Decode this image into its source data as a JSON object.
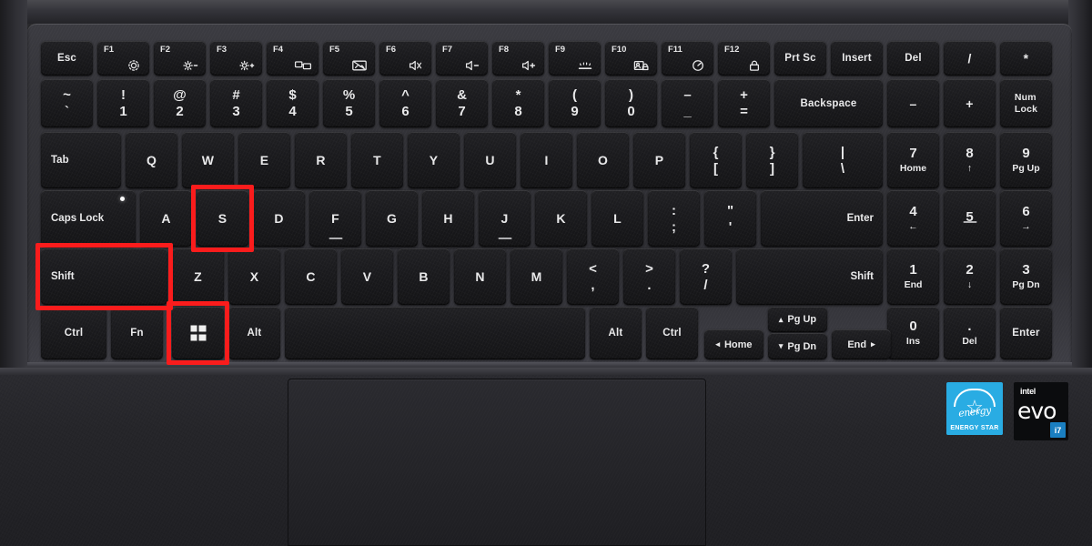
{
  "device": {
    "type": "laptop-keyboard",
    "highlight_color": "#fa1c1c",
    "highlighted_keys": [
      "S",
      "Shift",
      "Windows"
    ],
    "shortcut": "Windows + Shift + S"
  },
  "badges": {
    "energy_star": {
      "caption": "ENERGY STAR",
      "script": "energy",
      "color": "#29ace3"
    },
    "intel_evo": {
      "brand": "intel",
      "word": "evo",
      "tier": "i7",
      "color": "#1a7fc1"
    }
  },
  "rows": {
    "function_row": [
      {
        "id": "esc",
        "label": "Esc",
        "style": "center-small"
      },
      {
        "id": "f1",
        "fx": "F1",
        "icon": "gear-icon"
      },
      {
        "id": "f2",
        "fx": "F2",
        "icon": "brightness-down-icon"
      },
      {
        "id": "f3",
        "fx": "F3",
        "icon": "brightness-up-icon"
      },
      {
        "id": "f4",
        "fx": "F4",
        "icon": "display-switch-icon"
      },
      {
        "id": "f5",
        "fx": "F5",
        "icon": "screen-off-icon"
      },
      {
        "id": "f6",
        "fx": "F6",
        "icon": "mute-icon"
      },
      {
        "id": "f7",
        "fx": "F7",
        "icon": "volume-down-icon"
      },
      {
        "id": "f8",
        "fx": "F8",
        "icon": "volume-up-icon"
      },
      {
        "id": "f9",
        "fx": "F9",
        "icon": "keyboard-backlight-icon"
      },
      {
        "id": "f10",
        "fx": "F10",
        "icon": "privacy-lock-icon"
      },
      {
        "id": "f11",
        "fx": "F11",
        "icon": "performance-gauge-icon"
      },
      {
        "id": "f12",
        "fx": "F12",
        "icon": "lock-icon"
      },
      {
        "id": "prtsc",
        "label": "Prt Sc",
        "style": "center-small"
      },
      {
        "id": "insert",
        "label": "Insert",
        "style": "center-small"
      },
      {
        "id": "del",
        "label": "Del",
        "style": "center-small"
      },
      {
        "id": "numpad-divide",
        "label": "/",
        "style": "center"
      },
      {
        "id": "numpad-multiply",
        "label": "*",
        "style": "center"
      },
      {
        "id": "power",
        "label": "",
        "style": "center"
      }
    ],
    "number_row": [
      {
        "id": "backtick",
        "up": "~",
        "lo": "`"
      },
      {
        "id": "1",
        "up": "!",
        "lo": "1"
      },
      {
        "id": "2",
        "up": "@",
        "lo": "2"
      },
      {
        "id": "3",
        "up": "#",
        "lo": "3"
      },
      {
        "id": "4",
        "up": "$",
        "lo": "4"
      },
      {
        "id": "5",
        "up": "%",
        "lo": "5"
      },
      {
        "id": "6",
        "up": "^",
        "lo": "6"
      },
      {
        "id": "7",
        "up": "&",
        "lo": "7"
      },
      {
        "id": "8",
        "up": "*",
        "lo": "8"
      },
      {
        "id": "9",
        "up": "(",
        "lo": "9"
      },
      {
        "id": "0",
        "up": ")",
        "lo": "0"
      },
      {
        "id": "minus",
        "up": "–",
        "lo": "_"
      },
      {
        "id": "equal",
        "up": "+",
        "lo": "="
      },
      {
        "id": "backspace",
        "label": "Backspace",
        "style": "center-small"
      },
      {
        "id": "numpad-minus",
        "label": "–",
        "style": "center"
      },
      {
        "id": "numpad-plus",
        "label": "+",
        "style": "center"
      },
      {
        "id": "numlock",
        "label": "Num\nLock",
        "style": "stack-word"
      }
    ],
    "top_letter_row": [
      {
        "id": "tab",
        "label": "Tab",
        "style": "left-small"
      },
      {
        "id": "q",
        "label": "Q"
      },
      {
        "id": "w",
        "label": "W"
      },
      {
        "id": "e",
        "label": "E"
      },
      {
        "id": "r",
        "label": "R"
      },
      {
        "id": "t",
        "label": "T"
      },
      {
        "id": "y",
        "label": "Y"
      },
      {
        "id": "u",
        "label": "U"
      },
      {
        "id": "i",
        "label": "I"
      },
      {
        "id": "o",
        "label": "O"
      },
      {
        "id": "p",
        "label": "P"
      },
      {
        "id": "bracket-left",
        "up": "{",
        "lo": "["
      },
      {
        "id": "bracket-right",
        "up": "}",
        "lo": "]"
      },
      {
        "id": "backslash",
        "up": "|",
        "lo": "\\"
      },
      {
        "id": "np7",
        "big": "7",
        "sub": "Home"
      },
      {
        "id": "np8",
        "big": "8",
        "sub": "↑"
      },
      {
        "id": "np9",
        "big": "9",
        "sub": "Pg Up"
      }
    ],
    "home_row": [
      {
        "id": "capslock",
        "label": "Caps Lock",
        "style": "left-small",
        "led": true
      },
      {
        "id": "a",
        "label": "A"
      },
      {
        "id": "s",
        "label": "S",
        "highlight": true
      },
      {
        "id": "d",
        "label": "D"
      },
      {
        "id": "f",
        "label": "F",
        "homing": true
      },
      {
        "id": "g",
        "label": "G"
      },
      {
        "id": "h",
        "label": "H"
      },
      {
        "id": "j",
        "label": "J",
        "homing": true
      },
      {
        "id": "k",
        "label": "K"
      },
      {
        "id": "l",
        "label": "L"
      },
      {
        "id": "semicolon",
        "up": ":",
        "lo": ";"
      },
      {
        "id": "quote",
        "up": "\"",
        "lo": "'"
      },
      {
        "id": "enter",
        "label": "Enter",
        "style": "right-small"
      },
      {
        "id": "np4",
        "big": "4",
        "sub": "←"
      },
      {
        "id": "np5",
        "big": "5",
        "sub": "",
        "homing": true
      },
      {
        "id": "np6",
        "big": "6",
        "sub": "→"
      }
    ],
    "bottom_letter_row": [
      {
        "id": "shift-left",
        "label": "Shift",
        "style": "left-small",
        "highlight": true
      },
      {
        "id": "z",
        "label": "Z"
      },
      {
        "id": "x",
        "label": "X"
      },
      {
        "id": "c",
        "label": "C"
      },
      {
        "id": "v",
        "label": "V"
      },
      {
        "id": "b",
        "label": "B"
      },
      {
        "id": "n",
        "label": "N"
      },
      {
        "id": "m",
        "label": "M"
      },
      {
        "id": "comma",
        "up": "<",
        "lo": ","
      },
      {
        "id": "period",
        "up": ">",
        "lo": "."
      },
      {
        "id": "slash",
        "up": "?",
        "lo": "/"
      },
      {
        "id": "shift-right",
        "label": "Shift",
        "style": "right-small"
      },
      {
        "id": "np1",
        "big": "1",
        "sub": "End"
      },
      {
        "id": "np2",
        "big": "2",
        "sub": "↓"
      },
      {
        "id": "np3",
        "big": "3",
        "sub": "Pg Dn"
      }
    ],
    "modifier_row": [
      {
        "id": "ctrl-left",
        "label": "Ctrl",
        "style": "center-small"
      },
      {
        "id": "fn",
        "label": "Fn",
        "style": "center-small"
      },
      {
        "id": "windows",
        "label": "",
        "icon": "windows-logo-icon",
        "highlight": true
      },
      {
        "id": "alt-left",
        "label": "Alt",
        "style": "center-small"
      },
      {
        "id": "space",
        "label": "",
        "style": "center"
      },
      {
        "id": "alt-right",
        "label": "Alt",
        "style": "center-small"
      },
      {
        "id": "ctrl-right",
        "label": "Ctrl",
        "style": "center-small"
      },
      {
        "id": "np0",
        "big": "0",
        "sub": "Ins"
      },
      {
        "id": "np-period",
        "big": ".",
        "sub": "Del"
      },
      {
        "id": "np-enter",
        "label": "Enter",
        "style": "center-small"
      }
    ],
    "arrow_cluster": [
      {
        "id": "arrow-left",
        "glyph": "◂",
        "label": "Home",
        "order": "glyph-first"
      },
      {
        "id": "arrow-up",
        "glyph": "▴",
        "label": "Pg Up",
        "order": "glyph-first"
      },
      {
        "id": "arrow-down",
        "glyph": "▾",
        "label": "Pg Dn",
        "order": "glyph-first"
      },
      {
        "id": "arrow-right",
        "glyph": "▸",
        "label": "End",
        "order": "label-first"
      }
    ]
  }
}
